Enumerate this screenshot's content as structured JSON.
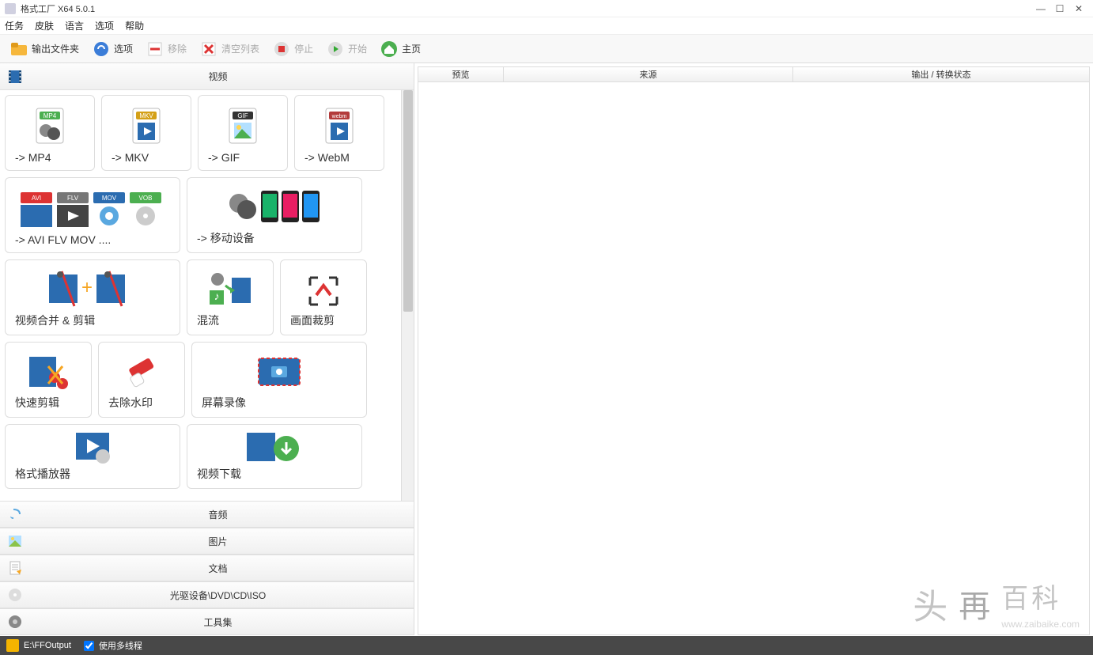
{
  "window": {
    "title": "格式工厂 X64 5.0.1"
  },
  "menu": [
    "任务",
    "皮肤",
    "语言",
    "选项",
    "帮助"
  ],
  "toolbar": {
    "output_folder": "输出文件夹",
    "options": "选项",
    "remove": "移除",
    "clear_list": "清空列表",
    "stop": "停止",
    "start": "开始",
    "home": "主页"
  },
  "categories": {
    "video": "视频",
    "audio": "音频",
    "image": "图片",
    "document": "文档",
    "optical": "光驱设备\\DVD\\CD\\ISO",
    "tools": "工具集"
  },
  "tiles": {
    "mp4": "-> MP4",
    "mkv": "-> MKV",
    "gif": "-> GIF",
    "webm": "-> WebM",
    "avi_etc": "-> AVI FLV MOV ....",
    "mobile": "-> 移动设备",
    "merge_edit": "视频合并 & 剪辑",
    "mux": "混流",
    "crop": "画面裁剪",
    "quick_cut": "快速剪辑",
    "remove_wm": "去除水印",
    "screen_rec": "屏幕录像",
    "player": "格式播放器",
    "video_dl": "视频下载"
  },
  "list_header": {
    "preview": "预览",
    "source": "来源",
    "output_status": "输出 / 转换状态"
  },
  "statusbar": {
    "output_path": "E:\\FFOutput",
    "multithread": "使用多线程"
  },
  "watermark": {
    "main": "再",
    "sub": "百科",
    "url": "www.zaibaike.com"
  }
}
